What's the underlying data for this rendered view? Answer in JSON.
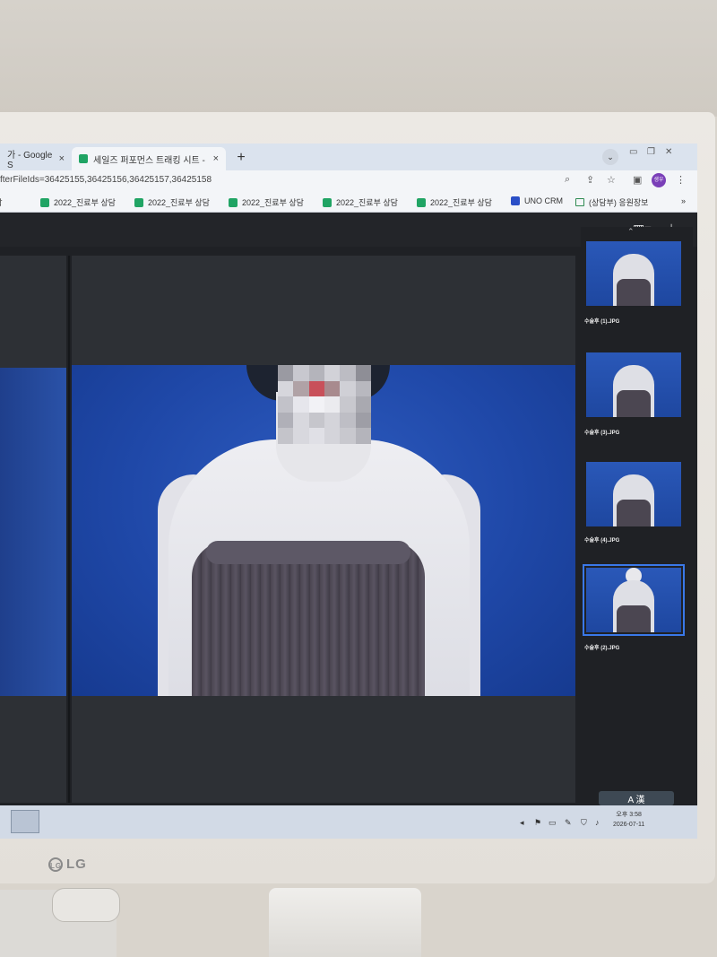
{
  "browser": {
    "tabs": [
      {
        "title": "가 - Google S",
        "close": "×"
      },
      {
        "title": "세일즈 퍼포먼스 트래킹 시트 - ",
        "close": "×"
      }
    ],
    "new_tab": "+",
    "url": "fterFileIds=36425155,36425156,36425157,36425158",
    "profile_initials": "생우",
    "bookmarks": [
      {
        "label": "상담",
        "icon": "green-sheet-icon"
      },
      {
        "label": "2022_진료부 상담",
        "icon": "green-sheet-icon"
      },
      {
        "label": "2022_진료부 상담",
        "icon": "green-sheet-icon"
      },
      {
        "label": "2022_진료부 상담",
        "icon": "green-sheet-icon"
      },
      {
        "label": "2022_진료부 상담",
        "icon": "green-sheet-icon"
      },
      {
        "label": "2022_진료부 상담",
        "icon": "green-sheet-icon"
      },
      {
        "label": "UNO CRM",
        "icon": "blue-app-icon"
      },
      {
        "label": "(상담부) 응원장보",
        "icon": "image-icon"
      }
    ],
    "bookmarks_overflow": "»"
  },
  "viewer": {
    "thumbnails": [
      {
        "label": "수술후 (1).JPG",
        "selected": false
      },
      {
        "label": "수술후 (3).JPG",
        "selected": false
      },
      {
        "label": "수술후 (4).JPG",
        "selected": false
      },
      {
        "label": "수술후 (2).JPG",
        "selected": true
      }
    ]
  },
  "taskbar": {
    "ime": "A 漢",
    "clock_time": "오후 3:58",
    "clock_date": "2026-07-11"
  },
  "monitor": {
    "brand": "LG"
  },
  "colors": {
    "accent": "#3a78e8",
    "photo_background": "#1f48a8",
    "viewer_background": "#1f2125"
  }
}
